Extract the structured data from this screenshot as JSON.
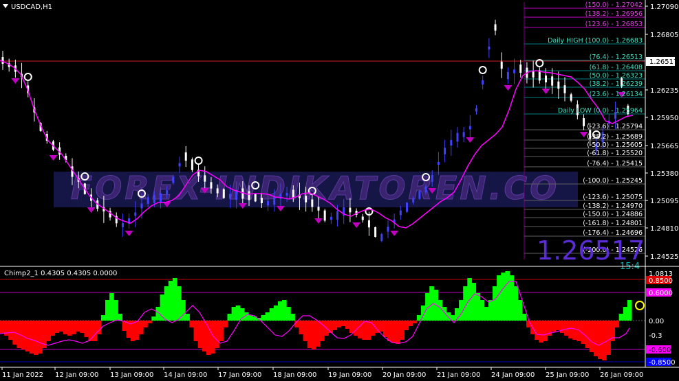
{
  "window": {
    "title": "USDCAD,H1",
    "arrow_icon": "triangle-down-icon"
  },
  "main": {
    "watermark": "FOREX-INDIKATOREN.CO",
    "big_price": "1.26517",
    "big_price_partial": "15:4",
    "current_price": "1.26517",
    "price_ticks": [
      "1.27090",
      "1.26805",
      "1.26235",
      "1.25950",
      "1.25665",
      "1.25380",
      "1.25095",
      "1.24810",
      "1.24525"
    ],
    "fib_upper": [
      {
        "label": "(150.0) - 1.27042",
        "color": "#e040e0"
      },
      {
        "label": "(138.2) - 1.26956",
        "color": "#e040e0"
      },
      {
        "label": "(123.6) - 1.26853",
        "color": "#e040e0"
      },
      {
        "label": "Daily HIGH (100.0) - 1.26683",
        "color": "#40e0c0"
      },
      {
        "label": "(76.4) - 1.26513",
        "color": "#40e0c0"
      },
      {
        "label": "(61.8) - 1.26408",
        "color": "#40e0c0"
      },
      {
        "label": "(50.0) - 1.26323",
        "color": "#40e0c0"
      },
      {
        "label": "(38.2) - 1.26239",
        "color": "#40e0c0"
      },
      {
        "label": "(23.6) - 1.26134",
        "color": "#40e0c0"
      },
      {
        "label": "Daily LOW (0.0) - 1.25964",
        "color": "#40e0c0"
      }
    ],
    "fib_lower": [
      {
        "label": "(-23.6) - 1.25794",
        "color": "#ffffff"
      },
      {
        "label": "(-38.2) - 1.25689",
        "color": "#ffffff"
      },
      {
        "label": "(-50.0) - 1.25605",
        "color": "#ffffff"
      },
      {
        "label": "(-61.8) - 1.25520",
        "color": "#ffffff"
      },
      {
        "label": "(-76.4) - 1.25415",
        "color": "#ffffff"
      },
      {
        "label": "(-100.0) - 1.25245",
        "color": "#ffffff"
      },
      {
        "label": "(-123.6) - 1.25075",
        "color": "#ffffff"
      },
      {
        "label": "(-138.2) - 1.24970",
        "color": "#ffffff"
      },
      {
        "label": "(-150.0) - 1.24886",
        "color": "#ffffff"
      },
      {
        "label": "(-161.8) - 1.24801",
        "color": "#ffffff"
      },
      {
        "label": "(-176.4) - 1.24696",
        "color": "#ffffff"
      },
      {
        "label": "(-200.0) - 1.24526",
        "color": "#ffffff"
      }
    ]
  },
  "indicator": {
    "title": "Chimp2_1 0.4305 0.4305 0.0000",
    "ticks": [
      {
        "label": "1.0813",
        "box": "none",
        "color": "#ffffff"
      },
      {
        "label": "0.8500",
        "box": "#e00000",
        "color": "#ffffff"
      },
      {
        "label": "0.6000",
        "box": "#ff00ff",
        "color": "#ffffff"
      },
      {
        "label": "0.00",
        "box": "none",
        "color": "#ffffff"
      },
      {
        "label": "-0.3",
        "box": "none",
        "color": "#ffffff"
      },
      {
        "label": "-0.6000",
        "box": "#ff00ff",
        "color": "#000000"
      },
      {
        "label": "-0.8500",
        "box": "#0000ff",
        "color": "#ffffff"
      }
    ],
    "bullet_icon": "circle-marker-icon"
  },
  "time_axis": [
    "11 Jan 2022",
    "12 Jan 09:00",
    "13 Jan 09:00",
    "14 Jan 09:00",
    "17 Jan 09:00",
    "18 Jan 09:00",
    "19 Jan 09:00",
    "20 Jan 09:00",
    "21 Jan 09:00",
    "24 Jan 09:00",
    "25 Jan 09:00",
    "26 Jan 09:00"
  ],
  "colors": {
    "bull_candle": "#4040ff",
    "bear_candle": "#ffffff",
    "ma": "#ff00ff",
    "hist_pos": "#00ff00",
    "hist_neg": "#ff0000",
    "signal": "#ff00ff",
    "price_line": "#ff2020"
  }
}
